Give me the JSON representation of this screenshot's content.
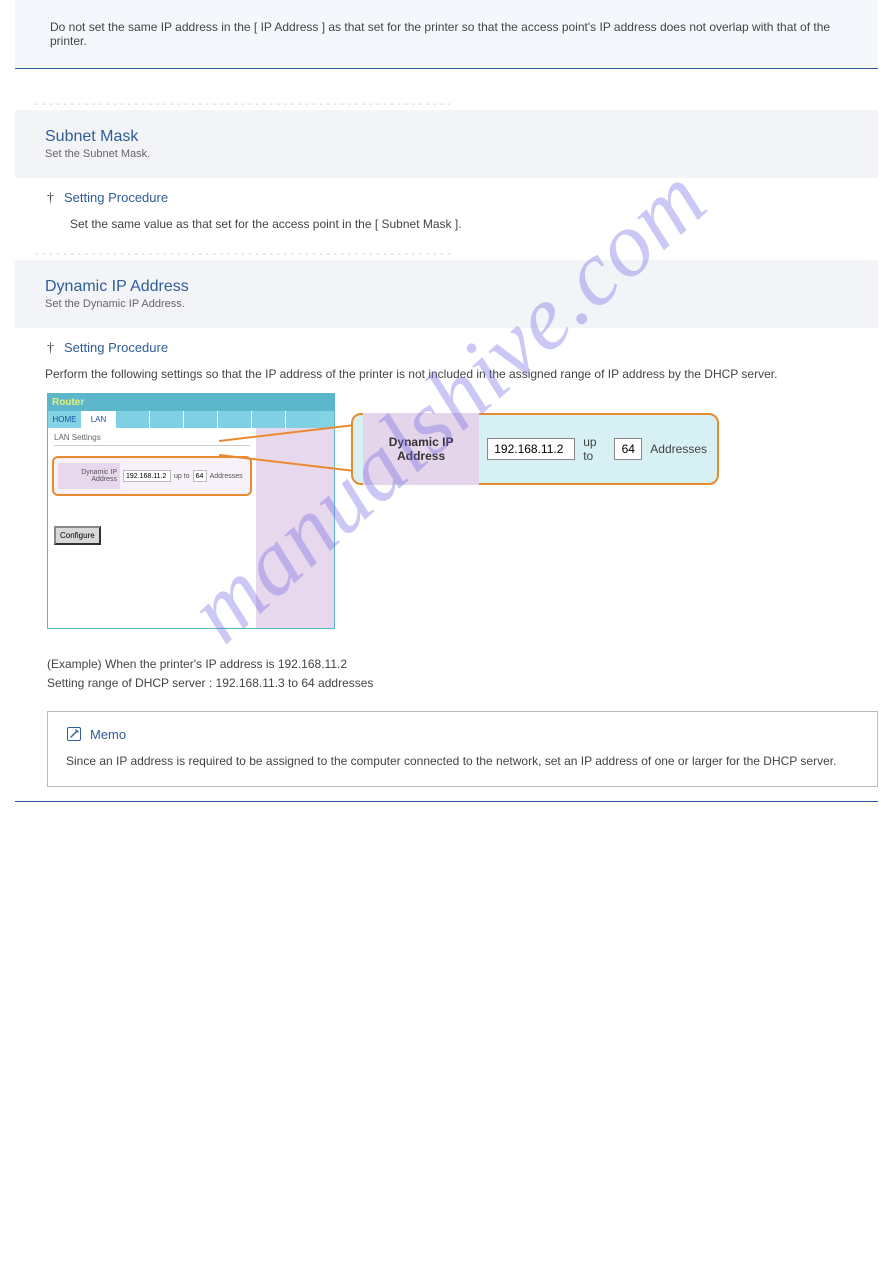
{
  "topnote": "Do not set the same IP address in the [ IP Address ] as that set for the printer so that the access point's IP address does not overlap with that of the printer.",
  "dash_row": "-  -  -  -  -  -  -  -  -  -  -  -  -  -  -  -  -  -  -  -  -  -  -  -  -  -  -  -  -  -  -  -  -  -  -  -  -  -  -  -  -  -  -  -  -  -  -  -  -  -  -  -  -  -  -  -  -  -  -",
  "param1": {
    "title": "Subnet Mask",
    "sub": "Set the Subnet Mask.",
    "cross_label": "Setting Procedure",
    "desc": "Set the same value as that set for the access point in the [ Subnet Mask ]."
  },
  "param2": {
    "title": "Dynamic IP Address",
    "sub": "Set the Dynamic IP Address.",
    "cross_label": "Setting Procedure",
    "cue": "Perform the following settings so that the IP address of the printer is not included in the assigned range of IP address by the DHCP server."
  },
  "router_ui": {
    "title": "Router",
    "tabs": {
      "home": "HOME",
      "lan": "LAN"
    },
    "section": "LAN Settings",
    "callout_label": "Dynamic IP Address",
    "ip_value": "192.168.11.2",
    "upto": "up to",
    "count_value": "64",
    "addresses": "Addresses",
    "configure": "Configure"
  },
  "postfig": {
    "line1": "(Example) When the printer's IP address is 192.168.11.2",
    "line2": "Setting range of DHCP server : 192.168.11.3 to 64 addresses"
  },
  "note": {
    "heading": "Memo",
    "body": "Since an IP address is required to be assigned to the computer connected to the network, set an IP address of one or larger for the DHCP server."
  },
  "watermark": "manualshive.com"
}
